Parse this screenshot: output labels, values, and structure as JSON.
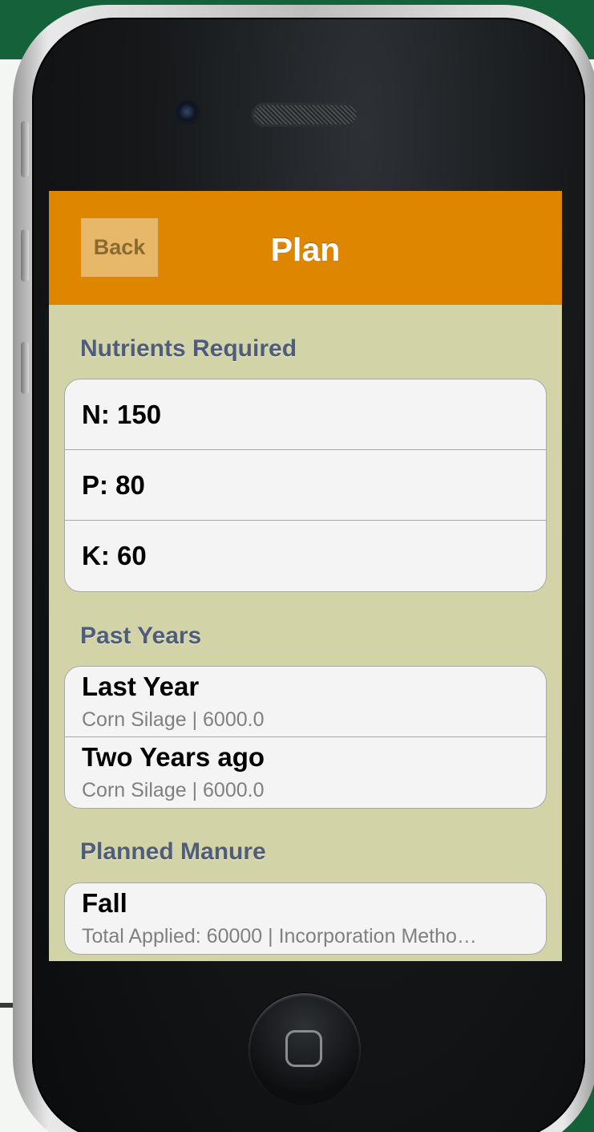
{
  "nav": {
    "back_label": "Back",
    "title": "Plan"
  },
  "sections": {
    "nutrients": {
      "header": "Nutrients Required",
      "rows": [
        "N: 150",
        "P: 80",
        "K: 60"
      ]
    },
    "past_years": {
      "header": "Past Years",
      "rows": [
        {
          "title": "Last Year",
          "subtitle": "Corn Silage | 6000.0"
        },
        {
          "title": "Two Years ago",
          "subtitle": "Corn Silage | 6000.0"
        }
      ]
    },
    "planned_manure": {
      "header": "Planned Manure",
      "rows": [
        {
          "title": "Fall",
          "subtitle": "Total Applied: 60000 | Incorporation Metho…"
        }
      ]
    }
  },
  "colors": {
    "navbar": "#df8600",
    "background": "#d3d3a8",
    "section_header": "#4f5d79",
    "cell_background": "#f4f4f4"
  },
  "icons": {
    "home_button": "home-square-icon"
  }
}
